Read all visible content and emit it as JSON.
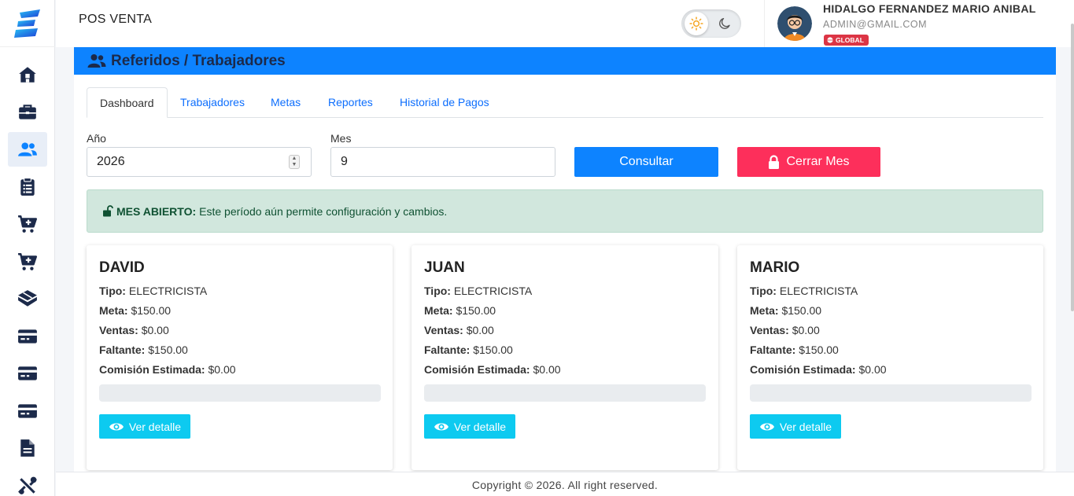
{
  "header": {
    "app_title": "POS VENTA",
    "user_name": "HIDALGO FERNANDEZ MARIO ANIBAL",
    "user_email": "ADMIN@GMAIL.COM",
    "user_badge": "GLOBAL",
    "theme": "light"
  },
  "sidebar": {
    "items": [
      {
        "icon": "home-icon",
        "active": false
      },
      {
        "icon": "briefcase-icon",
        "active": false
      },
      {
        "icon": "users-icon",
        "active": true
      },
      {
        "icon": "clipboard-icon",
        "active": false
      },
      {
        "icon": "cart-plus-icon",
        "active": false
      },
      {
        "icon": "cart-plus-icon",
        "active": false
      },
      {
        "icon": "box-icon",
        "active": false
      },
      {
        "icon": "credit-card-icon",
        "active": false
      },
      {
        "icon": "credit-card-icon",
        "active": false
      },
      {
        "icon": "credit-card-icon",
        "active": false
      },
      {
        "icon": "file-icon",
        "active": false
      },
      {
        "icon": "tools-icon",
        "active": false
      }
    ]
  },
  "page": {
    "title": "Referidos / Trabajadores",
    "tabs": [
      "Dashboard",
      "Trabajadores",
      "Metas",
      "Reportes",
      "Historial de Pagos"
    ],
    "active_tab": "Dashboard"
  },
  "filters": {
    "year_label": "Año",
    "year_value": "2026",
    "month_label": "Mes",
    "month_value": "9",
    "consultar_label": "Consultar",
    "cerrar_label": "Cerrar Mes"
  },
  "alert": {
    "strong": "MES ABIERTO:",
    "text": "Este período aún permite configuración y cambios."
  },
  "labels": {
    "tipo": "Tipo:",
    "meta": "Meta:",
    "ventas": "Ventas:",
    "faltante": "Faltante:",
    "comision": "Comisión Estimada:",
    "detalle": "Ver detalle"
  },
  "workers": [
    {
      "name": "DAVID",
      "tipo": "ELECTRICISTA",
      "meta": "$150.00",
      "ventas": "$0.00",
      "faltante": "$150.00",
      "comision": "$0.00",
      "progress": 0
    },
    {
      "name": "JUAN",
      "tipo": "ELECTRICISTA",
      "meta": "$150.00",
      "ventas": "$0.00",
      "faltante": "$150.00",
      "comision": "$0.00",
      "progress": 0
    },
    {
      "name": "MARIO",
      "tipo": "ELECTRICISTA",
      "meta": "$150.00",
      "ventas": "$0.00",
      "faltante": "$150.00",
      "comision": "$0.00",
      "progress": 0
    }
  ],
  "footer": {
    "text": "Copyright © 2026. All right reserved."
  },
  "colors": {
    "primary": "#0d83ff",
    "danger": "#fd2f5b",
    "info": "#0dcaf0",
    "success_bg": "#d1e7dd",
    "sidebar_icon": "#1c2a4a"
  }
}
